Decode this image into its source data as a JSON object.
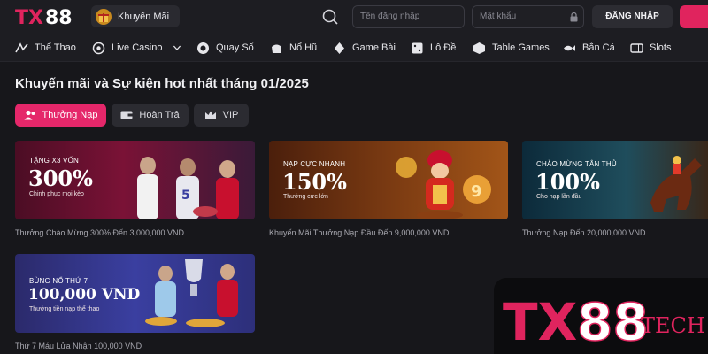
{
  "header": {
    "logo_text": "TX88",
    "promo_label": "Khuyến Mãi",
    "username_placeholder": "Tên đăng nhập",
    "password_placeholder": "Mật khẩu",
    "login_label": "ĐĂNG NHẬP",
    "register_label": "",
    "brand_color": "#e0245e"
  },
  "nav": {
    "items": [
      {
        "label": "Thể Thao",
        "icon": "sports-icon"
      },
      {
        "label": "Live Casino",
        "icon": "live-casino-icon"
      },
      {
        "label": "Quay Số",
        "icon": "lottery-ball-icon"
      },
      {
        "label": "Nổ Hũ",
        "icon": "jackpot-icon"
      },
      {
        "label": "Game Bài",
        "icon": "cards-icon"
      },
      {
        "label": "Lô Đề",
        "icon": "dice-icon"
      },
      {
        "label": "Table Games",
        "icon": "table-games-icon"
      },
      {
        "label": "Bắn Cá",
        "icon": "fish-icon"
      },
      {
        "label": "Slots",
        "icon": "slots-icon"
      }
    ]
  },
  "page": {
    "title": "Khuyến mãi và Sự kiện hot nhất tháng 01/2025"
  },
  "tabs": [
    {
      "label": "Thưởng Nạp",
      "icon": "user-group-icon",
      "active": true
    },
    {
      "label": "Hoàn Trả",
      "icon": "wallet-icon",
      "active": false
    },
    {
      "label": "VIP",
      "icon": "crown-icon",
      "active": false
    }
  ],
  "promotions": [
    {
      "banner_line1": "TẶNG X3 VỐN",
      "banner_big": "300%",
      "banner_line2": "Chinh phục mọi kèo",
      "caption": "Thưởng Chào Mừng 300% Đến 3,000,000 VND"
    },
    {
      "banner_line1": "NẠP CỰC NHANH",
      "banner_big": "150%",
      "banner_line2": "Thưởng cực lớn",
      "caption": "Khuyến Mãi Thưởng Nạp Đầu Đến 9,000,000 VND"
    },
    {
      "banner_line1": "CHÀO MỪNG TÂN THỦ",
      "banner_big": "100%",
      "banner_line2": "Cho nạp lần đầu",
      "caption": "Thưởng Nạp Đến 20,000,000 VND"
    },
    {
      "banner_line1": "BÙNG NỔ THỨ 7",
      "banner_big": "100,000 VND",
      "banner_line2": "Thưởng tiền nạp thể thao",
      "caption": "Thứ 7 Máu Lửa Nhận 100,000 VND"
    }
  ],
  "watermark": {
    "text_main": "TX88",
    "text_suffix": "TECH"
  }
}
